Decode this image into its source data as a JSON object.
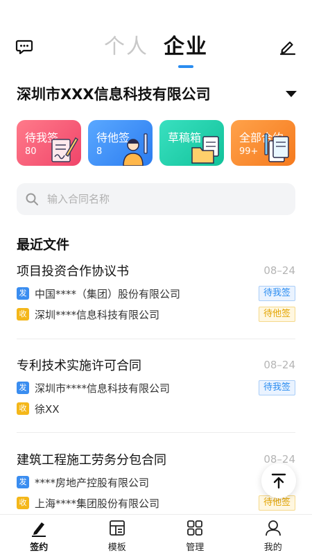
{
  "header": {
    "tabs": [
      {
        "label": "个人",
        "active": false
      },
      {
        "label": "企业",
        "active": true
      }
    ],
    "left_icon": "message-icon",
    "right_icon": "edit-icon",
    "accent_color": "#2a8cf0"
  },
  "company": {
    "name": "深圳市XXX信息科技有限公司",
    "dropdown_icon": "caret-down-icon"
  },
  "cards": [
    {
      "label": "待我签",
      "count": "80",
      "icon": "sign-doc-icon"
    },
    {
      "label": "待他签",
      "count": "8",
      "icon": "person-icon"
    },
    {
      "label": "草稿箱",
      "count": "",
      "icon": "folder-doc-icon"
    },
    {
      "label": "全部合约",
      "count": "99+",
      "icon": "contract-stack-icon"
    }
  ],
  "search": {
    "placeholder": "输入合同名称"
  },
  "recent": {
    "title": "最近文件",
    "docs": [
      {
        "title": "项目投资合作协议书",
        "date": "08–24",
        "sender_tag": "发",
        "sender": "中国****（集团）股份有限公司",
        "sender_status": "待我签",
        "receiver_tag": "收",
        "receiver": "深圳****信息科技有限公司",
        "receiver_status": "待他签"
      },
      {
        "title": "专利技术实施许可合同",
        "date": "08–24",
        "sender_tag": "发",
        "sender": "深圳市****信息科技有限公司",
        "sender_status": "待我签",
        "receiver_tag": "收",
        "receiver": "徐XX",
        "receiver_status": ""
      },
      {
        "title": "建筑工程施工劳务分包合同",
        "date": "08–24",
        "sender_tag": "发",
        "sender": "****房地产控股有限公司",
        "sender_status": "",
        "receiver_tag": "收",
        "receiver": "上海****集团股份有限公司",
        "receiver_status": "待他签"
      }
    ]
  },
  "bottom_nav": [
    {
      "label": "签约",
      "icon": "pen-icon",
      "active": true
    },
    {
      "label": "模板",
      "icon": "template-icon",
      "active": false
    },
    {
      "label": "管理",
      "icon": "grid-icon",
      "active": false
    },
    {
      "label": "我的",
      "icon": "user-icon",
      "active": false
    }
  ]
}
